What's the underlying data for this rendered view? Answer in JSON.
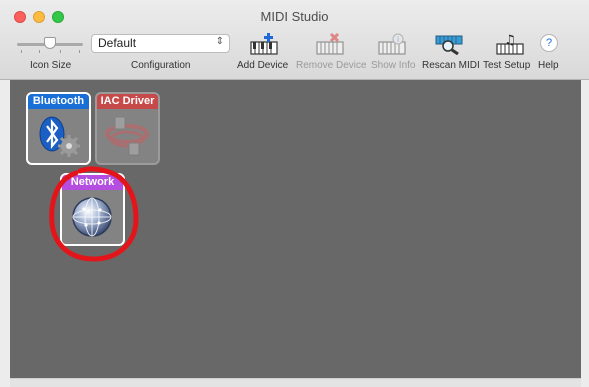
{
  "window": {
    "title": "MIDI Studio"
  },
  "toolbar": {
    "icon_size_label": "Icon Size",
    "configuration_label": "Configuration",
    "configuration_value": "Default",
    "add_device_label": "Add Device",
    "remove_device_label": "Remove Device",
    "show_info_label": "Show Info",
    "rescan_midi_label": "Rescan MIDI",
    "test_setup_label": "Test Setup",
    "help_label": "Help",
    "help_glyph": "?"
  },
  "devices": [
    {
      "name": "Bluetooth",
      "label_color": "#1a6fd6",
      "online": true,
      "icon": "bluetooth-gear-icon"
    },
    {
      "name": "IAC Driver",
      "label_color": "#c64a4a",
      "online": false,
      "icon": "iac-driver-icon"
    },
    {
      "name": "Network",
      "label_color": "#b44de0",
      "online": true,
      "icon": "network-globe-icon"
    }
  ],
  "annotation": {
    "color": "#e3151b",
    "shape": "hand-drawn-circle"
  }
}
